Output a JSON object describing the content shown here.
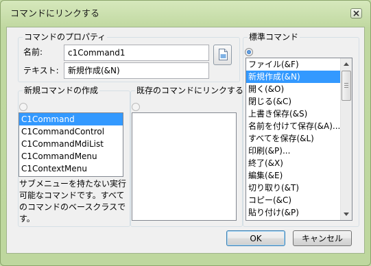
{
  "window": {
    "title": "コマンドにリンクする",
    "close_label": "×"
  },
  "properties_group": {
    "legend": "コマンドのプロパティ",
    "name_label": "名前:",
    "name_value": "c1Command1",
    "text_label": "テキスト:",
    "text_value": "新規作成(&N)",
    "image_button_icon": "image-icon"
  },
  "new_command_group": {
    "legend": "新規コマンドの作成",
    "radio_checked": false,
    "items": [
      "C1Command",
      "C1CommandControl",
      "C1CommandMdiList",
      "C1CommandMenu",
      "C1ContextMenu"
    ],
    "selected_index": 0,
    "description": "サブメニューを持たない実行可能なコマンドです。すべてのコマンドのベースクラスです。"
  },
  "existing_group": {
    "legend": "既存のコマンドにリンクする",
    "radio_checked": false
  },
  "standard_group": {
    "legend": "標準コマンド",
    "radio_checked": true,
    "items": [
      "ファイル(&F)",
      "新規作成(&N)",
      "開く(&O)",
      "閉じる(&C)",
      "上書き保存(&S)",
      "名前を付けて保存(&A)...",
      "すべてを保存(&L)",
      "印刷(&P)...",
      "終了(&X)",
      "編集(&E)",
      "切り取り(&T)",
      "コピー(&C)",
      "貼り付け(&P)"
    ],
    "selected_index": 1,
    "scroll_position": 0.1
  },
  "buttons": {
    "ok": "OK",
    "cancel": "キャンセル"
  },
  "colors": {
    "frame": "#c4dba6",
    "selection": "#3399ff",
    "dialog_face": "#f0f0f0"
  }
}
